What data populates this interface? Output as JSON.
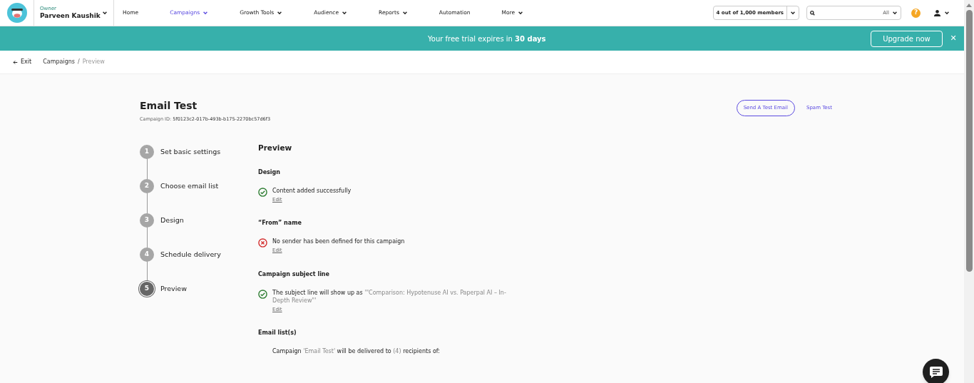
{
  "account": {
    "role": "Owner",
    "name": "Parveen Kaushik"
  },
  "nav": [
    {
      "label": "Home",
      "selected": false,
      "dropdown": false
    },
    {
      "label": "Campaigns",
      "selected": true,
      "dropdown": true
    },
    {
      "label": "Growth Tools",
      "selected": false,
      "dropdown": true
    },
    {
      "label": "Audience",
      "selected": false,
      "dropdown": true
    },
    {
      "label": "Reports",
      "selected": false,
      "dropdown": true
    },
    {
      "label": "Automation",
      "selected": false,
      "dropdown": false
    },
    {
      "label": "More",
      "selected": false,
      "dropdown": true
    }
  ],
  "members": "4 out of 1,000 members",
  "search": {
    "scope": "All"
  },
  "help_icon": "?",
  "banner": {
    "text": "Your free trial expires in **30 days**",
    "button": "Upgrade now",
    "close": "✕"
  },
  "breadcrumb": {
    "exit": "Exit",
    "separator": "/",
    "items": [
      "Campaigns",
      "Preview"
    ]
  },
  "campaign": {
    "title": "Email Test",
    "id_label": "Campaign ID:",
    "id": "5f0123c2-017b-493b-b175-2270bc57d6f3"
  },
  "actions": {
    "test_email": "Send A Test Email",
    "spam_test": "Spam Test"
  },
  "steps": [
    {
      "number": "1",
      "label": "Set basic settings",
      "selected": false
    },
    {
      "number": "2",
      "label": "Choose email list",
      "selected": false
    },
    {
      "number": "3",
      "label": "Design",
      "selected": false
    },
    {
      "number": "4",
      "label": "Schedule delivery",
      "selected": false
    },
    {
      "number": "5",
      "label": "Preview",
      "selected": true
    }
  ],
  "preview": {
    "heading": "Preview",
    "sections": [
      {
        "title": "Design",
        "kind": "success",
        "parts": [
          {
            "text": "Content added successfully",
            "muted": false
          }
        ],
        "edit": "Edit"
      },
      {
        "title": "“From” name",
        "kind": "error",
        "parts": [
          {
            "text": "No sender has been defined for this campaign",
            "muted": false
          }
        ],
        "edit": "Edit"
      },
      {
        "title": "Campaign subject line",
        "kind": "success",
        "parts": [
          {
            "text": "The subject line will show up as ",
            "muted": false
          },
          {
            "text": "'\"Comparison: Hypotenuse AI vs. Paperpal AI – In-Depth Review\"'",
            "muted": true
          }
        ],
        "edit": "Edit"
      },
      {
        "title": "Email list(s)",
        "kind": "plain",
        "parts": [
          {
            "text": "Campaign ",
            "muted": false
          },
          {
            "text": "'Email Test'",
            "muted": true
          },
          {
            "text": " will be delivered to ",
            "muted": false
          },
          {
            "text": "(4)",
            "muted": true
          },
          {
            "text": " recipients of:",
            "muted": false
          }
        ]
      }
    ]
  }
}
